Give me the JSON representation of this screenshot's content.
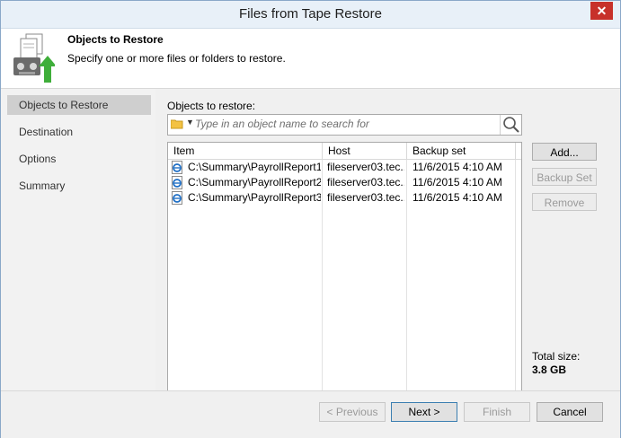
{
  "window": {
    "title": "Files from Tape Restore"
  },
  "header": {
    "title": "Objects to Restore",
    "subtitle": "Specify one or more files or folders to restore."
  },
  "sidebar": {
    "items": [
      {
        "label": "Objects to Restore",
        "active": true
      },
      {
        "label": "Destination",
        "active": false
      },
      {
        "label": "Options",
        "active": false
      },
      {
        "label": "Summary",
        "active": false
      }
    ]
  },
  "main": {
    "objects_label": "Objects to restore:",
    "search": {
      "placeholder": "Type in an object name to search for"
    },
    "table": {
      "columns": [
        "Item",
        "Host",
        "Backup set"
      ],
      "rows": [
        {
          "item": "C:\\Summary\\PayrollReport1....",
          "host": "fileserver03.tec...",
          "backup_set": "11/6/2015 4:10 AM"
        },
        {
          "item": "C:\\Summary\\PayrollReport2....",
          "host": "fileserver03.tec...",
          "backup_set": "11/6/2015 4:10 AM"
        },
        {
          "item": "C:\\Summary\\PayrollReport3....",
          "host": "fileserver03.tec...",
          "backup_set": "11/6/2015 4:10 AM"
        }
      ]
    },
    "buttons": {
      "add": "Add...",
      "backup_set": "Backup Set",
      "remove": "Remove"
    },
    "total_size_label": "Total size:",
    "total_size_value": "3.8 GB"
  },
  "footer": {
    "previous": "< Previous",
    "next": "Next >",
    "finish": "Finish",
    "cancel": "Cancel"
  },
  "colors": {
    "accent": "#3c7fb1",
    "close_button": "#c7312a",
    "sidebar_active": "#cfcfcf"
  }
}
